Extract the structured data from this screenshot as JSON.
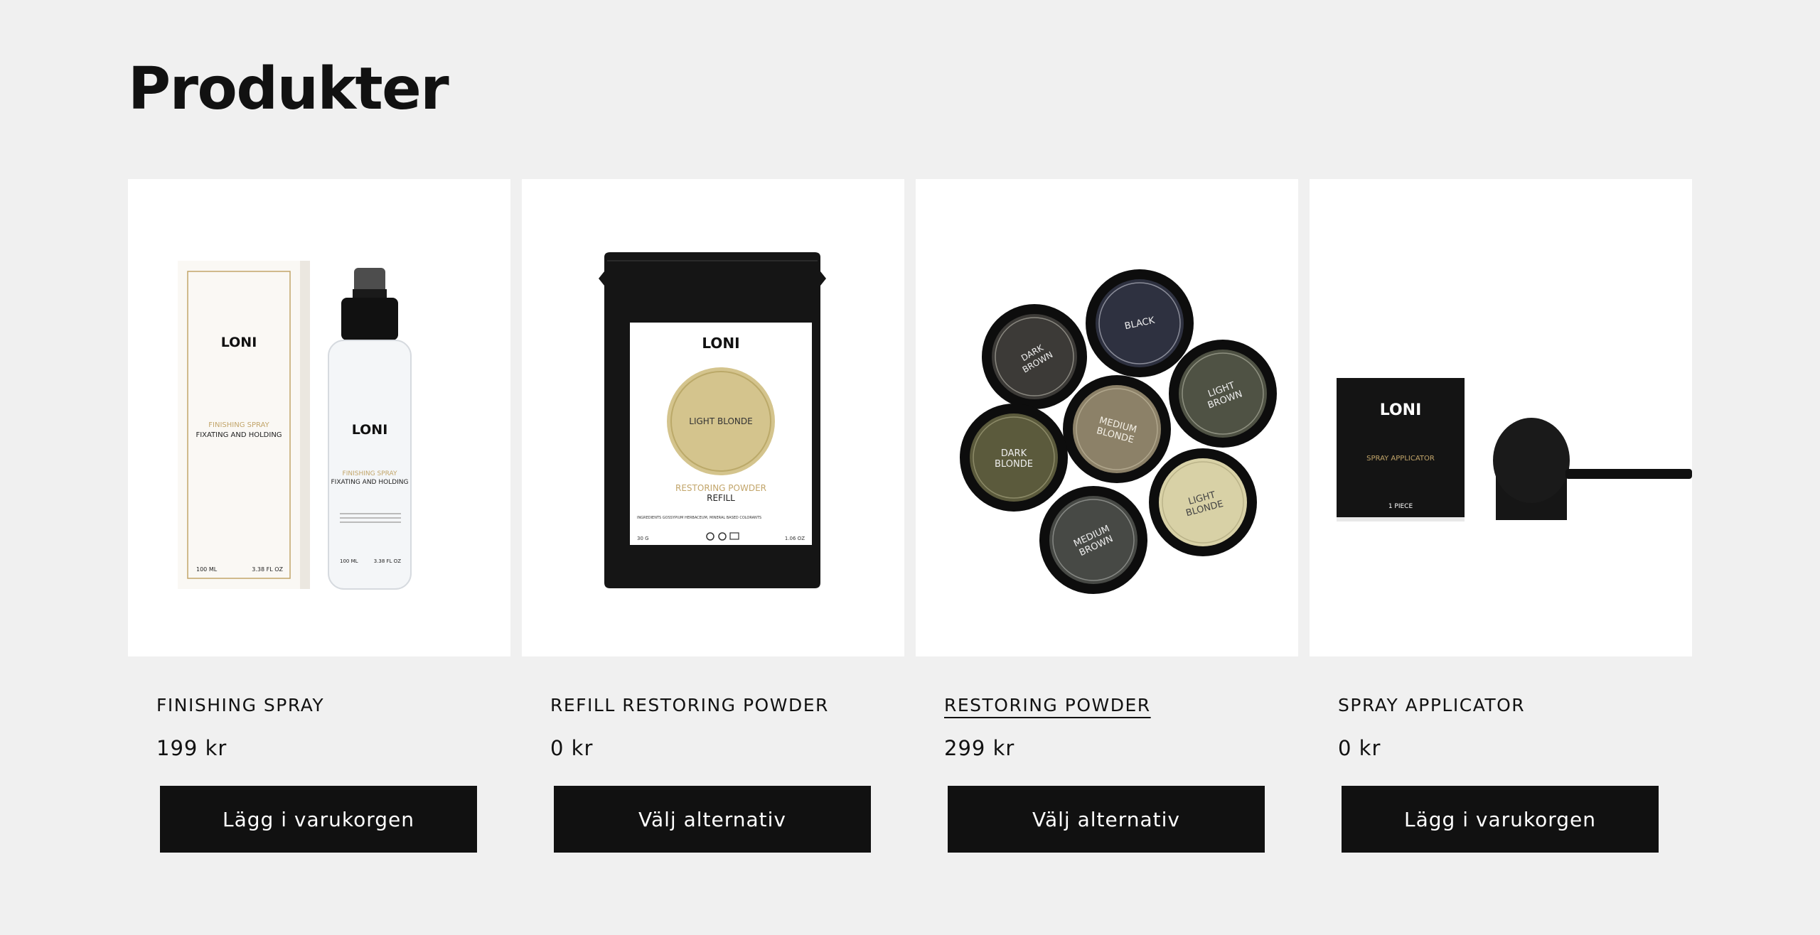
{
  "page": {
    "title": "Produkter"
  },
  "brand": "LONI",
  "products": [
    {
      "name": "FINISHING SPRAY",
      "price": "199 kr",
      "button": "Lägg i varukorgen",
      "image": {
        "box_line1": "FINISHING SPRAY",
        "box_line2": "FIXATING AND HOLDING",
        "box_volume_ml": "100 ML",
        "box_volume_oz": "3.38 FL OZ",
        "bottle_line1": "FINISHING SPRAY",
        "bottle_line2": "FIXATING AND HOLDING",
        "bottle_volume_ml": "100 ML",
        "bottle_volume_oz": "3.38 FL OZ"
      }
    },
    {
      "name": "REFILL RESTORING POWDER",
      "price": "0 kr",
      "button": "Välj alternativ",
      "image": {
        "shade": "LIGHT BLONDE",
        "line1": "RESTORING POWDER",
        "line2": "REFILL",
        "ingredients": "INGREDIENTS GOSSYPIUM HERBACEUM, MINERAL BASED COLORANTS",
        "weight_g": "30 G",
        "weight_oz": "1.06 OZ"
      }
    },
    {
      "name": "RESTORING POWDER",
      "price": "299 kr",
      "button": "Välj alternativ",
      "image": {
        "shades": [
          {
            "l1": "DARK",
            "l2": "BROWN"
          },
          {
            "l1": "BLACK",
            "l2": ""
          },
          {
            "l1": "LIGHT",
            "l2": "BROWN"
          },
          {
            "l1": "MEDIUM",
            "l2": "BLONDE"
          },
          {
            "l1": "DARK",
            "l2": "BLONDE"
          },
          {
            "l1": "LIGHT",
            "l2": "BLONDE"
          },
          {
            "l1": "MEDIUM",
            "l2": "BROWN"
          }
        ]
      }
    },
    {
      "name": "SPRAY APPLICATOR",
      "price": "0 kr",
      "button": "Lägg i varukorgen",
      "image": {
        "box_line": "SPRAY APPLICATOR",
        "box_count": "1 PIECE"
      }
    }
  ],
  "colors": {
    "background": "#f0f0f0",
    "button_bg": "#111111",
    "button_text": "#ffffff",
    "gold": "#c2a56a"
  }
}
